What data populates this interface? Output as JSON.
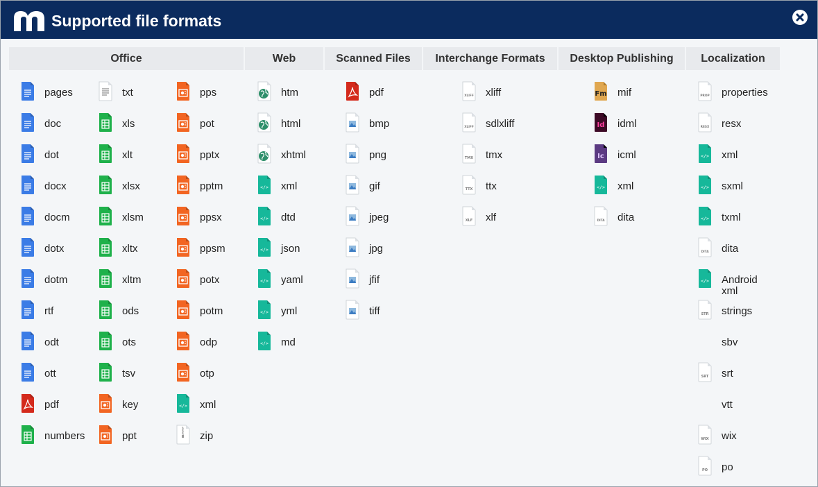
{
  "dialog": {
    "title": "Supported file formats",
    "close_icon": "close-circle-icon",
    "logo_icon": "app-logo-icon"
  },
  "colors": {
    "titlebar": "#0b2b5e",
    "doc": "#3b7ce6",
    "sheet": "#1fb14b",
    "slide": "#f26522",
    "code": "#16b89a",
    "pdf": "#d42a1c",
    "fm": "#e0a750",
    "id": "#3d0a26",
    "ic": "#5b3a82"
  },
  "columns": [
    {
      "id": "office",
      "heading": "Office",
      "items": [
        {
          "label": "pages",
          "icon": "doc"
        },
        {
          "label": "doc",
          "icon": "doc"
        },
        {
          "label": "dot",
          "icon": "doc"
        },
        {
          "label": "docx",
          "icon": "doc"
        },
        {
          "label": "docm",
          "icon": "doc"
        },
        {
          "label": "dotx",
          "icon": "doc"
        },
        {
          "label": "dotm",
          "icon": "doc"
        },
        {
          "label": "rtf",
          "icon": "doc"
        },
        {
          "label": "odt",
          "icon": "doc"
        },
        {
          "label": "ott",
          "icon": "doc"
        },
        {
          "label": "pdf",
          "icon": "pdf"
        },
        {
          "label": "numbers",
          "icon": "sheet"
        },
        {
          "label": "txt",
          "icon": "txt"
        },
        {
          "label": "xls",
          "icon": "sheet"
        },
        {
          "label": "xlt",
          "icon": "sheet"
        },
        {
          "label": "xlsx",
          "icon": "sheet"
        },
        {
          "label": "xlsm",
          "icon": "sheet"
        },
        {
          "label": "xltx",
          "icon": "sheet"
        },
        {
          "label": "xltm",
          "icon": "sheet"
        },
        {
          "label": "ods",
          "icon": "sheet"
        },
        {
          "label": "ots",
          "icon": "sheet"
        },
        {
          "label": "tsv",
          "icon": "sheet"
        },
        {
          "label": "key",
          "icon": "slide"
        },
        {
          "label": "ppt",
          "icon": "slide"
        },
        {
          "label": "pps",
          "icon": "slide"
        },
        {
          "label": "pot",
          "icon": "slide"
        },
        {
          "label": "pptx",
          "icon": "slide"
        },
        {
          "label": "pptm",
          "icon": "slide"
        },
        {
          "label": "ppsx",
          "icon": "slide"
        },
        {
          "label": "ppsm",
          "icon": "slide"
        },
        {
          "label": "potx",
          "icon": "slide"
        },
        {
          "label": "potm",
          "icon": "slide"
        },
        {
          "label": "odp",
          "icon": "slide"
        },
        {
          "label": "otp",
          "icon": "slide"
        },
        {
          "label": "xml",
          "icon": "code"
        },
        {
          "label": "zip",
          "icon": "zip"
        }
      ]
    },
    {
      "id": "web",
      "heading": "Web",
      "items": [
        {
          "label": "htm",
          "icon": "web"
        },
        {
          "label": "html",
          "icon": "web"
        },
        {
          "label": "xhtml",
          "icon": "web"
        },
        {
          "label": "xml",
          "icon": "code"
        },
        {
          "label": "dtd",
          "icon": "code"
        },
        {
          "label": "json",
          "icon": "code"
        },
        {
          "label": "yaml",
          "icon": "code"
        },
        {
          "label": "yml",
          "icon": "code"
        },
        {
          "label": "md",
          "icon": "code"
        }
      ]
    },
    {
      "id": "scanned",
      "heading": "Scanned Files",
      "items": [
        {
          "label": "pdf",
          "icon": "pdf"
        },
        {
          "label": "bmp",
          "icon": "image"
        },
        {
          "label": "png",
          "icon": "image"
        },
        {
          "label": "gif",
          "icon": "image"
        },
        {
          "label": "jpeg",
          "icon": "image"
        },
        {
          "label": "jpg",
          "icon": "image"
        },
        {
          "label": "jfif",
          "icon": "image"
        },
        {
          "label": "tiff",
          "icon": "image"
        }
      ]
    },
    {
      "id": "interchange",
      "heading": "Interchange Formats",
      "items": [
        {
          "label": "xliff",
          "icon": "generic",
          "tag": "XLIFF"
        },
        {
          "label": "sdlxliff",
          "icon": "generic",
          "tag": "XLIFF"
        },
        {
          "label": "tmx",
          "icon": "generic",
          "tag": "TMX"
        },
        {
          "label": "ttx",
          "icon": "generic",
          "tag": "TTX"
        },
        {
          "label": "xlf",
          "icon": "generic",
          "tag": "XLF"
        }
      ]
    },
    {
      "id": "dtp",
      "heading": "Desktop Publishing",
      "items": [
        {
          "label": "mif",
          "icon": "fm",
          "tag": "Fm"
        },
        {
          "label": "idml",
          "icon": "id",
          "tag": "Id"
        },
        {
          "label": "icml",
          "icon": "ic",
          "tag": "Ic"
        },
        {
          "label": "xml",
          "icon": "code"
        },
        {
          "label": "dita",
          "icon": "generic",
          "tag": "DITA"
        }
      ]
    },
    {
      "id": "localization",
      "heading": "Localization",
      "items": [
        {
          "label": "properties",
          "icon": "generic",
          "tag": "PROP"
        },
        {
          "label": "resx",
          "icon": "generic",
          "tag": "RESX"
        },
        {
          "label": "xml",
          "icon": "code"
        },
        {
          "label": "sxml",
          "icon": "code"
        },
        {
          "label": "txml",
          "icon": "code"
        },
        {
          "label": "dita",
          "icon": "generic",
          "tag": "DITA"
        },
        {
          "label": "Android xml",
          "icon": "code"
        },
        {
          "label": "strings",
          "icon": "generic",
          "tag": "STR"
        },
        {
          "label": "sbv",
          "icon": "none"
        },
        {
          "label": "srt",
          "icon": "generic",
          "tag": "SRT"
        },
        {
          "label": "vtt",
          "icon": "none"
        },
        {
          "label": "wix",
          "icon": "generic",
          "tag": "WIX"
        },
        {
          "label": "po",
          "icon": "generic",
          "tag": "PO"
        }
      ]
    }
  ]
}
